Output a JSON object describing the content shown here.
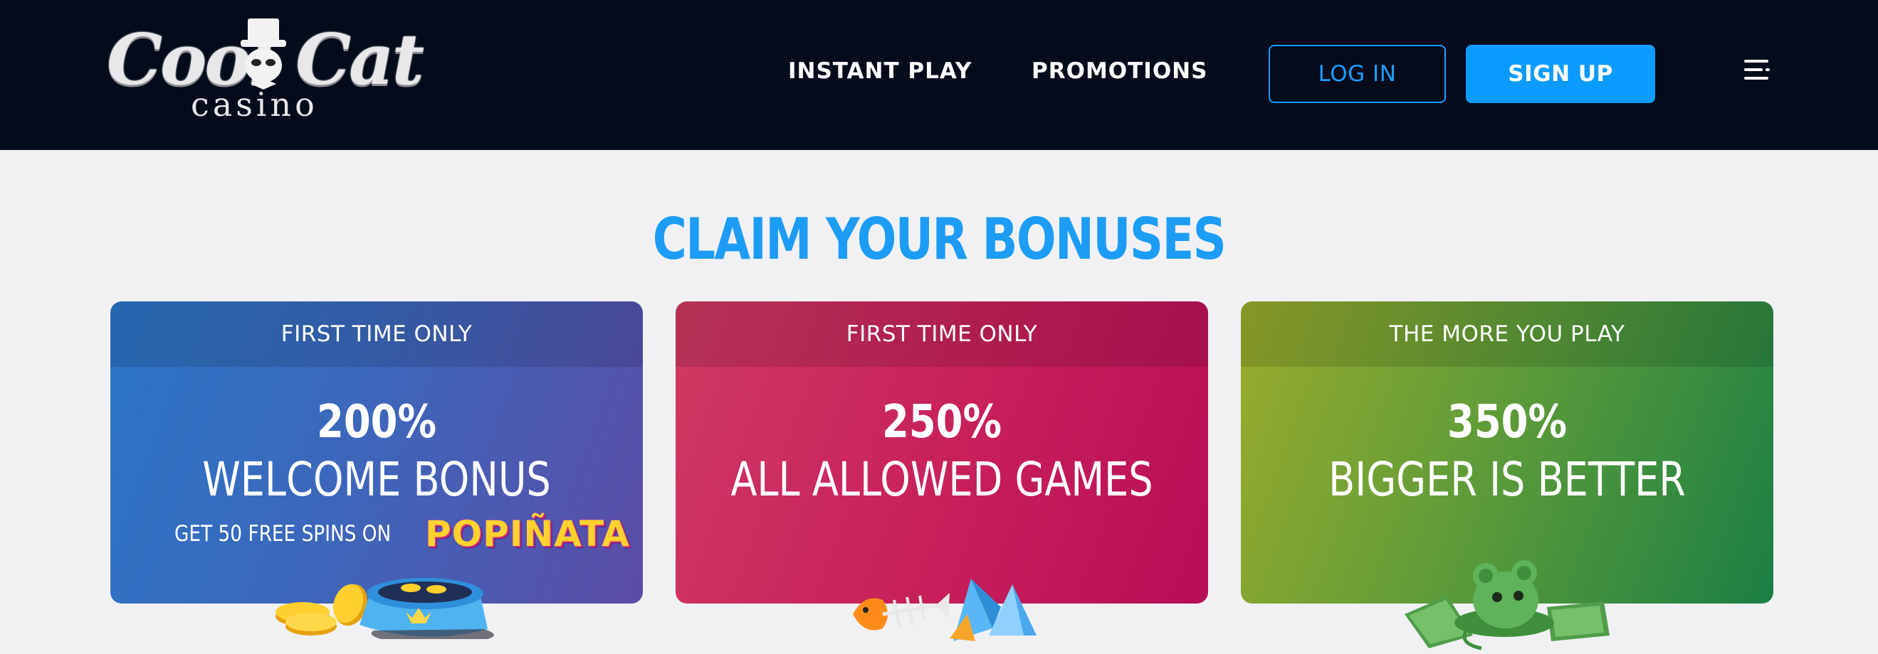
{
  "header": {
    "logo_main": "Cool Cat",
    "logo_sub": "casino",
    "nav": [
      {
        "label": "INSTANT PLAY"
      },
      {
        "label": "PROMOTIONS"
      }
    ],
    "login_label": "LOG IN",
    "signup_label": "SIGN UP",
    "menu_icon": "hamburger-menu-icon"
  },
  "main": {
    "title": "CLAIM YOUR BONUSES",
    "cards": [
      {
        "header": "FIRST TIME ONLY",
        "percent": "200%",
        "subtitle": "WELCOME BONUS",
        "extra": "GET 50 FREE SPINS ON",
        "extra_game": "POPIÑATA",
        "illustration": "coins-and-cat-bowl-icon"
      },
      {
        "header": "FIRST TIME ONLY",
        "percent": "250%",
        "subtitle": "ALL ALLOWED GAMES",
        "illustration": "fish-bone-and-crystals-icon"
      },
      {
        "header": "THE MORE YOU PLAY",
        "percent": "350%",
        "subtitle": "BIGGER IS BETTER",
        "illustration": "mouse-and-cash-icon"
      }
    ]
  },
  "colors": {
    "header_bg": "#040b1b",
    "accent_blue": "#0a9bff",
    "page_bg": "#f1f1f4",
    "title_blue": "#1d9cf5"
  }
}
